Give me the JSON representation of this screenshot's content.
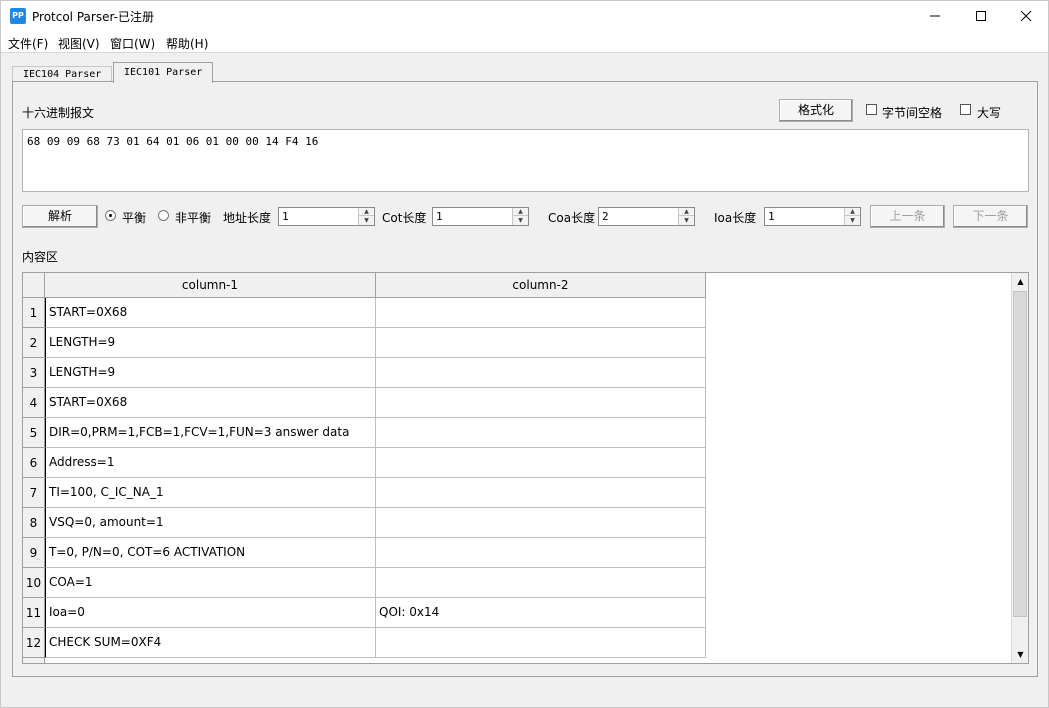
{
  "window": {
    "title": "Protcol Parser-已注册",
    "icon_text": "PP",
    "controls": [
      "minimize-icon",
      "maximize-icon",
      "close-icon"
    ]
  },
  "menu": [
    "文件(F)",
    "视图(V)",
    "窗口(W)",
    "帮助(H)"
  ],
  "tabs": [
    {
      "label": "IEC104 Parser",
      "active": false
    },
    {
      "label": "IEC101 Parser",
      "active": true
    }
  ],
  "hex_section": {
    "label": "十六进制报文",
    "format_button": "格式化",
    "byte_space_label": "字节间空格",
    "byte_space_checked": false,
    "uppercase_label": "大写",
    "uppercase_checked": false,
    "hex_value": "68 09 09 68 73 01 64 01 06 01 00 00 14 F4 16"
  },
  "controls": {
    "parse_button": "解析",
    "balanced_label": "平衡",
    "balanced_checked": true,
    "unbalanced_label": "非平衡",
    "unbalanced_checked": false,
    "addr_len_label": "地址长度",
    "addr_len_value": "1",
    "cot_len_label": "Cot长度",
    "cot_len_value": "1",
    "coa_len_label": "Coa长度",
    "coa_len_value": "2",
    "ioa_len_label": "Ioa长度",
    "ioa_len_value": "1",
    "prev_button": "上一条",
    "next_button": "下一条"
  },
  "content": {
    "label": "内容区",
    "columns": [
      "column-1",
      "column-2"
    ],
    "rows": [
      {
        "num": "1",
        "c1": "START=0X68",
        "c2": ""
      },
      {
        "num": "2",
        "c1": "LENGTH=9",
        "c2": ""
      },
      {
        "num": "3",
        "c1": "LENGTH=9",
        "c2": ""
      },
      {
        "num": "4",
        "c1": "START=0X68",
        "c2": ""
      },
      {
        "num": "5",
        "c1": "DIR=0,PRM=1,FCB=1,FCV=1,FUN=3 answer data",
        "c2": ""
      },
      {
        "num": "6",
        "c1": "Address=1",
        "c2": ""
      },
      {
        "num": "7",
        "c1": "TI=100, C_IC_NA_1",
        "c2": ""
      },
      {
        "num": "8",
        "c1": "VSQ=0, amount=1",
        "c2": ""
      },
      {
        "num": "9",
        "c1": "T=0, P/N=0, COT=6 ACTIVATION",
        "c2": ""
      },
      {
        "num": "10",
        "c1": "COA=1",
        "c2": ""
      },
      {
        "num": "11",
        "c1": "Ioa=0",
        "c2": "QOI: 0x14"
      },
      {
        "num": "12",
        "c1": "CHECK SUM=0XF4",
        "c2": ""
      }
    ]
  }
}
